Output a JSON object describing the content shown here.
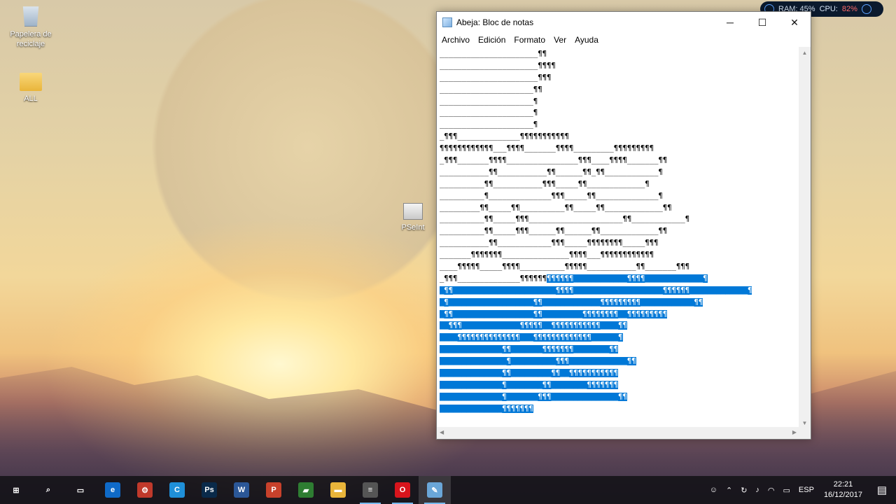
{
  "desktop": {
    "icons": [
      {
        "label": "Papelera de reciclaje"
      },
      {
        "label": "ALL"
      },
      {
        "label": "PSeInt"
      }
    ]
  },
  "perf_widget": {
    "ram": "RAM: 45%",
    "cpu_label": "CPU:",
    "cpu_value": "82%"
  },
  "notepad": {
    "title": "Abeja: Bloc de notas",
    "menu": [
      "Archivo",
      "Edición",
      "Formato",
      "Ver",
      "Ayuda"
    ],
    "lines": [
      {
        "text": "______________________¶¶",
        "sel": ""
      },
      {
        "text": "______________________¶¶¶¶",
        "sel": ""
      },
      {
        "text": "______________________¶¶¶",
        "sel": ""
      },
      {
        "text": "_____________________¶¶",
        "sel": ""
      },
      {
        "text": "_____________________¶",
        "sel": ""
      },
      {
        "text": "_____________________¶",
        "sel": ""
      },
      {
        "text": "_____________________¶",
        "sel": ""
      },
      {
        "text": "_¶¶¶______________¶¶¶¶¶¶¶¶¶¶¶",
        "sel": ""
      },
      {
        "text": "¶¶¶¶¶¶¶¶¶¶¶¶___¶¶¶¶_______¶¶¶¶_________¶¶¶¶¶¶¶¶¶",
        "sel": ""
      },
      {
        "text": "_¶¶¶_______¶¶¶¶________________¶¶¶____¶¶¶¶_______¶¶",
        "sel": ""
      },
      {
        "text": "___________¶¶___________¶¶______¶¶_¶¶____________¶",
        "sel": ""
      },
      {
        "text": "__________¶¶___________¶¶¶_____¶¶_____________¶",
        "sel": ""
      },
      {
        "text": "__________¶______________¶¶¶_____¶¶______________¶",
        "sel": ""
      },
      {
        "text": "_________¶¶_____¶¶__________¶¶_____¶¶_____________¶¶",
        "sel": ""
      },
      {
        "text": "__________¶¶_____¶¶¶_____________________¶¶____________¶",
        "sel": ""
      },
      {
        "text": "__________¶¶_____¶¶¶______¶¶______¶¶_____________¶¶",
        "sel": ""
      },
      {
        "text": "___________¶¶____________¶¶¶_____¶¶¶¶¶¶¶¶_____¶¶¶",
        "sel": ""
      },
      {
        "text": "_______¶¶¶¶¶¶¶_______________¶¶¶¶___¶¶¶¶¶¶¶¶¶¶¶¶",
        "sel": ""
      },
      {
        "text": "____¶¶¶¶¶_____¶¶¶¶__________¶¶¶¶¶___________¶¶_______¶¶¶",
        "sel": ""
      },
      {
        "text": "_¶¶¶______________¶¶¶¶¶¶",
        "sel": "¶¶¶¶¶¶____________¶¶¶¶_____________¶"
      },
      {
        "text": "",
        "sel": "_¶¶_______________________¶¶¶¶____________________¶¶¶¶¶¶_____________¶"
      },
      {
        "text": "",
        "sel": "_¶___________________¶¶_____________¶¶¶¶¶¶¶¶¶____________¶¶"
      },
      {
        "text": "",
        "sel": "_¶¶__________________¶¶_________¶¶¶¶¶¶¶¶__¶¶¶¶¶¶¶¶¶"
      },
      {
        "text": "",
        "sel": "__¶¶¶_____________¶¶¶¶¶__¶¶¶¶¶¶¶¶¶¶¶____¶¶"
      },
      {
        "text": "",
        "sel": "____¶¶¶¶¶¶¶¶¶¶¶¶¶¶___¶¶¶¶¶¶¶¶¶¶¶¶¶______¶"
      },
      {
        "text": "",
        "sel": "______________¶¶_______¶¶¶¶¶¶¶________¶¶"
      },
      {
        "text": "",
        "sel": "_______________¶__________¶¶¶_____________¶¶"
      },
      {
        "text": "",
        "sel": "______________¶¶_________¶¶__¶¶¶¶¶¶¶¶¶¶¶"
      },
      {
        "text": "",
        "sel": "______________¶________¶¶________¶¶¶¶¶¶¶"
      },
      {
        "text": "",
        "sel": "______________¶_______¶¶¶_______________¶¶"
      },
      {
        "text": "",
        "sel": "______________¶¶¶¶¶¶¶"
      }
    ]
  },
  "taskbar": {
    "apps": [
      {
        "icon": "start-icon",
        "glyph": "⊞",
        "color": "transparent"
      },
      {
        "icon": "search-icon",
        "glyph": "⌕",
        "color": "transparent"
      },
      {
        "icon": "task-view-icon",
        "glyph": "▭",
        "color": "transparent"
      },
      {
        "icon": "edge-icon",
        "glyph": "e",
        "color": "#0f6ac8"
      },
      {
        "icon": "tool-icon",
        "glyph": "⚙",
        "color": "#c0392b"
      },
      {
        "icon": "browser-icon",
        "glyph": "C",
        "color": "#1f8fd8"
      },
      {
        "icon": "photoshop-icon",
        "glyph": "Ps",
        "color": "#0a2a4a"
      },
      {
        "icon": "word-icon",
        "glyph": "W",
        "color": "#2b5797"
      },
      {
        "icon": "powerpoint-icon",
        "glyph": "P",
        "color": "#c8412b"
      },
      {
        "icon": "book-icon",
        "glyph": "▰",
        "color": "#2e7d32"
      },
      {
        "icon": "folder-icon",
        "glyph": "▬",
        "color": "#e9b53a"
      },
      {
        "icon": "pseint-icon",
        "glyph": "≡",
        "color": "#555555"
      },
      {
        "icon": "opera-icon",
        "glyph": "O",
        "color": "#d8141c"
      },
      {
        "icon": "notepad-icon",
        "glyph": "✎",
        "color": "#6aa6d8"
      }
    ],
    "tray": {
      "language": "ESP",
      "time": "22:21",
      "date": "16/12/2017"
    }
  }
}
